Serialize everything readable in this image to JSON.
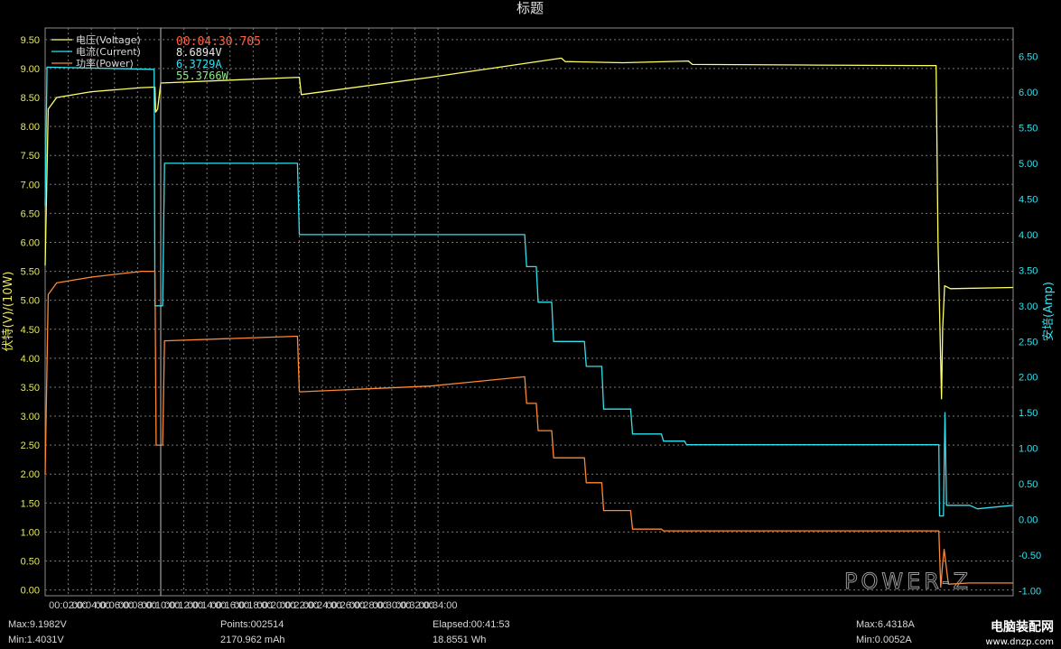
{
  "chart_data": {
    "type": "line",
    "title": "标题",
    "ylabel_left": "伏特(V)/(10W)",
    "ylabel_right": "安培(Amp)",
    "ylim_left": [
      -0.1,
      9.7
    ],
    "ylim_right": [
      -1.07,
      6.9
    ],
    "yticks_left": [
      "0.00",
      "0.50",
      "1.00",
      "1.50",
      "2.00",
      "2.50",
      "3.00",
      "3.50",
      "4.00",
      "4.50",
      "5.00",
      "5.50",
      "6.00",
      "6.50",
      "7.00",
      "7.50",
      "8.00",
      "8.50",
      "9.00",
      "9.50"
    ],
    "yticks_right": [
      "-1.00",
      "-0.50",
      "0.00",
      "0.50",
      "1.00",
      "1.50",
      "2.00",
      "2.50",
      "3.00",
      "3.50",
      "4.00",
      "4.50",
      "5.00",
      "5.50",
      "6.00",
      "6.50"
    ],
    "xlim": [
      0,
      2513
    ],
    "xticks": [
      "00:02:00",
      "00:04:00",
      "00:06:00",
      "00:08:00",
      "00:10:00",
      "00:12:00",
      "00:14:00",
      "00:16:00",
      "00:18:00",
      "00:20:00",
      "00:22:00",
      "00:24:00",
      "00:26:00",
      "00:28:00",
      "00:30:00",
      "00:32:00",
      "00:34:00"
    ],
    "grid": true,
    "cursor_time": "00:04:30.705",
    "legend": [
      {
        "label": "电压(Voltage)",
        "color": "#ffff66",
        "value": "8.6894V",
        "value_color": "#e8e8e8"
      },
      {
        "label": "电流(Current)",
        "color": "#33e0ee",
        "value": "6.3729A",
        "value_color": "#33e0ee"
      },
      {
        "label": "功率(Power)",
        "color": "#ff8833",
        "value": "55.3766W",
        "value_color": "#88ee88"
      }
    ],
    "series": [
      {
        "name": "电压(Voltage)",
        "axis": "left",
        "color": "#ffff66",
        "x": [
          0,
          8,
          30,
          120,
          250,
          285,
          287,
          292,
          300,
          660,
          665,
          1000,
          1340,
          1350,
          1500,
          1670,
          1680,
          2000,
          2313,
          2318,
          2327,
          2330,
          2335,
          2350,
          2513
        ],
        "y": [
          5.6,
          8.3,
          8.5,
          8.6,
          8.67,
          8.68,
          8.25,
          8.3,
          8.75,
          8.85,
          8.55,
          8.85,
          9.18,
          9.12,
          9.1,
          9.13,
          9.07,
          9.06,
          9.05,
          6.0,
          3.3,
          4.5,
          5.25,
          5.2,
          5.22
        ]
      },
      {
        "name": "电流(Current)",
        "axis": "right",
        "color": "#33e0ee",
        "x": [
          0,
          5,
          283,
          285,
          305,
          310,
          655,
          660,
          1245,
          1250,
          1275,
          1280,
          1315,
          1320,
          1400,
          1405,
          1445,
          1450,
          1520,
          1525,
          1600,
          1605,
          1660,
          1665,
          2320,
          2322,
          2332,
          2336,
          2340,
          2400,
          2420,
          2513
        ],
        "y": [
          4.4,
          6.35,
          6.32,
          3.0,
          3.0,
          5.0,
          5.0,
          4.0,
          4.0,
          3.55,
          3.55,
          3.05,
          3.05,
          2.5,
          2.5,
          2.15,
          2.15,
          1.55,
          1.55,
          1.2,
          1.2,
          1.1,
          1.1,
          1.05,
          1.05,
          0.05,
          0.05,
          1.5,
          0.2,
          0.2,
          0.15,
          0.2
        ]
      },
      {
        "name": "功率(Power)",
        "axis": "left",
        "color": "#ff8833",
        "x": [
          0,
          8,
          30,
          120,
          250,
          285,
          288,
          305,
          310,
          655,
          660,
          1000,
          1245,
          1250,
          1275,
          1280,
          1315,
          1320,
          1400,
          1405,
          1445,
          1450,
          1520,
          1525,
          1600,
          1605,
          2320,
          2325,
          2330,
          2334,
          2345,
          2400,
          2513
        ],
        "y": [
          2.0,
          5.1,
          5.3,
          5.4,
          5.5,
          5.5,
          2.5,
          2.5,
          4.3,
          4.38,
          3.42,
          3.52,
          3.68,
          3.22,
          3.22,
          2.75,
          2.75,
          2.28,
          2.28,
          1.85,
          1.85,
          1.37,
          1.37,
          1.05,
          1.05,
          1.02,
          1.02,
          0.05,
          0.45,
          0.7,
          0.1,
          0.12,
          0.12
        ]
      }
    ]
  },
  "stats": {
    "max_voltage": "Max:9.1982V",
    "min_voltage": "Min:1.4031V",
    "points": "Points:002514",
    "capacity_mah": "2170.962 mAh",
    "elapsed": "Elapsed:00:41:53",
    "energy_wh": "18.8551 Wh",
    "max_current": "Max:6.4318A",
    "min_current": "Min:0.0052A"
  },
  "watermark": {
    "logo_text": "POWER-Z",
    "site_name": "电脑装配网",
    "site_url": "www.dnzp.com"
  }
}
